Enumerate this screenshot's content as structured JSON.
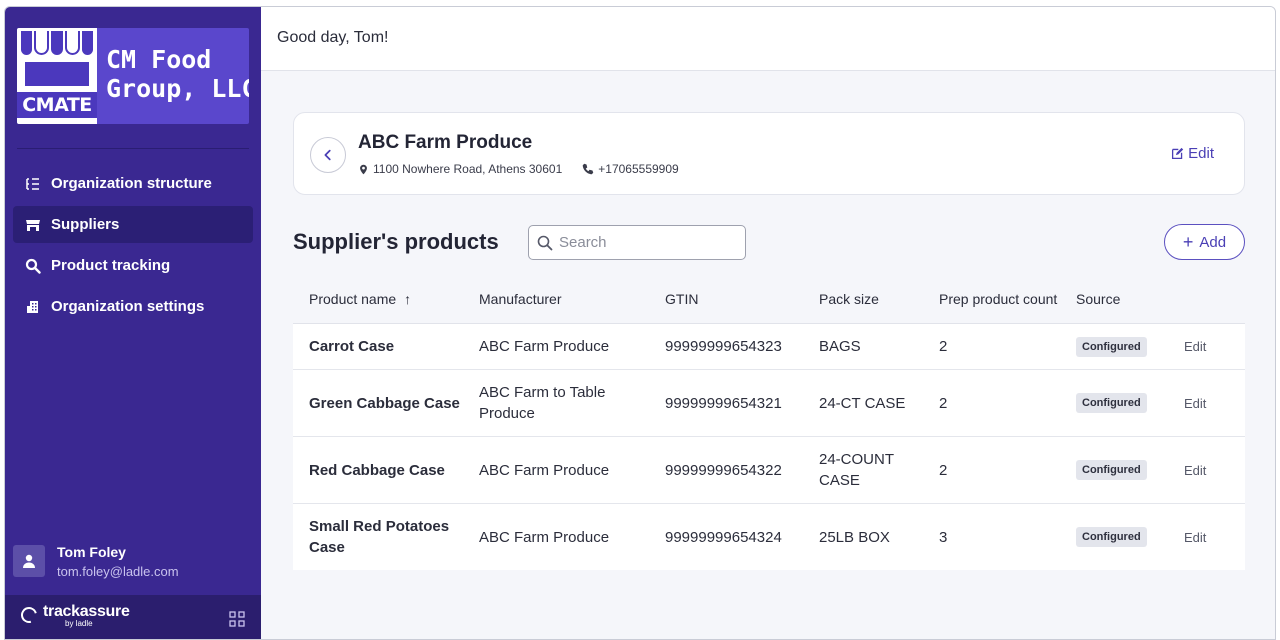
{
  "org": {
    "logo_mark": "CMATE",
    "name": "CM Food\nGroup, LLC"
  },
  "nav": {
    "items": [
      {
        "label": "Organization structure",
        "icon": "org-structure-icon"
      },
      {
        "label": "Suppliers",
        "icon": "store-icon",
        "active": true
      },
      {
        "label": "Product tracking",
        "icon": "search-icon"
      },
      {
        "label": "Organization settings",
        "icon": "building-icon"
      }
    ]
  },
  "user": {
    "name": "Tom Foley",
    "email": "tom.foley@ladle.com"
  },
  "brand": {
    "name": "trackassure",
    "by": "by ladle"
  },
  "header": {
    "greeting": "Good day, Tom!"
  },
  "supplier": {
    "name": "ABC Farm Produce",
    "address": "1100 Nowhere Road, Athens 30601",
    "phone": "+17065559909",
    "edit_label": "Edit"
  },
  "products": {
    "title": "Supplier's products",
    "search_placeholder": "Search",
    "add_label": "Add",
    "columns": [
      "Product name",
      "Manufacturer",
      "GTIN",
      "Pack size",
      "Prep product count",
      "Source"
    ],
    "sort_indicator": "↑",
    "rows": [
      {
        "name": "Carrot Case",
        "manufacturer": "ABC Farm Produce",
        "gtin": "99999999654323",
        "pack": "BAGS",
        "count": "2",
        "source": "Configured",
        "edit": "Edit"
      },
      {
        "name": "Green Cabbage Case",
        "manufacturer": "ABC Farm to Table Produce",
        "gtin": "99999999654321",
        "pack": "24-CT CASE",
        "count": "2",
        "source": "Configured",
        "edit": "Edit"
      },
      {
        "name": "Red Cabbage Case",
        "manufacturer": "ABC Farm Produce",
        "gtin": "99999999654322",
        "pack": "24-COUNT CASE",
        "count": "2",
        "source": "Configured",
        "edit": "Edit"
      },
      {
        "name": "Small Red Potatoes Case",
        "manufacturer": "ABC Farm Produce",
        "gtin": "99999999654324",
        "pack": "25LB BOX",
        "count": "3",
        "source": "Configured",
        "edit": "Edit"
      }
    ]
  },
  "colors": {
    "sidebar": "#3a2891",
    "accent": "#4a3fb5"
  }
}
